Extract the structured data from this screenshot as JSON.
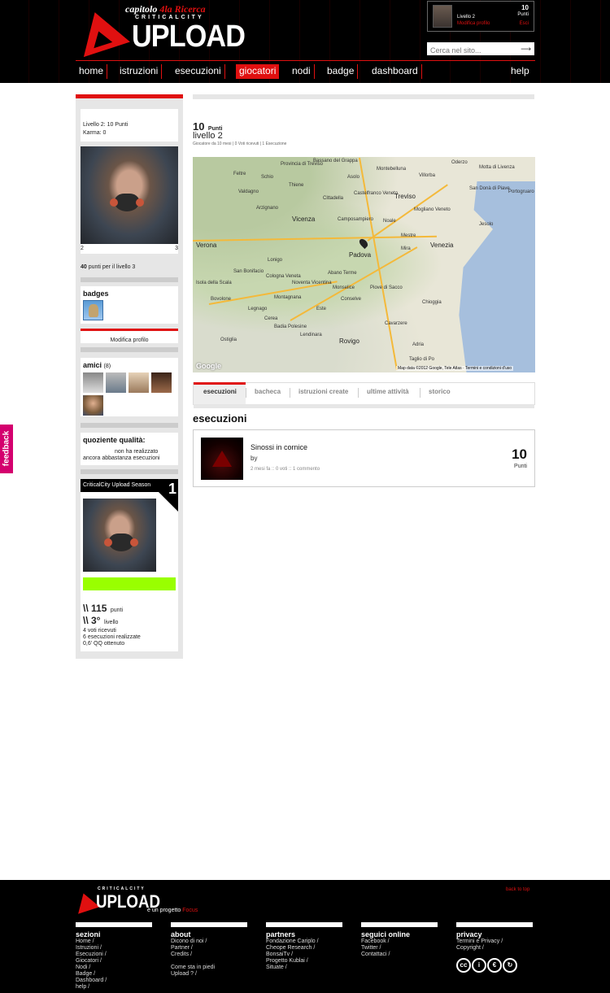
{
  "header": {
    "logo": {
      "kicker": "capitolo",
      "kicker_em": "4la Ricerca",
      "brand_small": "CRITICALCITY",
      "brand": "UPLOAD"
    },
    "user": {
      "level": "Livello 2",
      "edit": "Modifica profilo",
      "points": "10",
      "points_label": "Punti",
      "logout": "Esci"
    },
    "search": {
      "placeholder": "Cerca nel sito...",
      "go": "⟶"
    },
    "nav": [
      "home",
      "istruzioni",
      "esecuzioni",
      "giocatori",
      "nodi",
      "badge",
      "dashboard",
      "help"
    ],
    "nav_active": "giocatori"
  },
  "sidebar": {
    "level_line": "Livello 2: 10 Punti",
    "karma_line": "Karma: 0",
    "progress_left": "2",
    "progress_right": "3",
    "points_next_num": "40",
    "points_next_text": " punti per il livello 3",
    "badges_title": "badges",
    "edit_profile": "Modifica profilo",
    "friends_title": "amici",
    "friends_count": "(8)",
    "quality_title": "quoziente qualità:",
    "quality_text_1": "non ha realizzato",
    "quality_text_2": "ancora abbastanza esecuzioni",
    "season_title": "CriticalCity Upload Season",
    "season_num": "1",
    "season_points_num": "\\\\ 115",
    "season_points_label": "punti",
    "season_level_num": "\\\\ 3°",
    "season_level_label": "livello",
    "stat_votes": "4 voti ricevuti",
    "stat_execs": "6 esecuzioni realizzate",
    "stat_qq": "0,6' QQ ottenuto",
    "season_bar_color": "#99ff00"
  },
  "profile": {
    "points": "10",
    "points_label": "Punti",
    "level": "livello 2",
    "meta": "Giocatore da 10 mesi  |  0 Voti ricevuti  |  1 Esecuzione"
  },
  "map": {
    "labels": [
      "Provincia di Treviso",
      "Bassano del Grappa",
      "Feltre",
      "Asolo",
      "Schio",
      "Thiene",
      "Cittadella",
      "Castelfranco Veneto",
      "Vicenza",
      "Camposampiero",
      "Treviso",
      "Villorba",
      "Oderzo",
      "Motta di Livenza",
      "San Donà di Piave",
      "Jesolo",
      "Padova",
      "Mestre",
      "Venezia",
      "Mira",
      "Chioggia",
      "Abano Terme",
      "Piove di Sacco",
      "Conselve",
      "Este",
      "Montagnana",
      "Legnago",
      "Rovigo",
      "Lendinara",
      "Badia Polesine",
      "Adria",
      "Cavarzere",
      "Taglio di Po",
      "Verona",
      "San Bonifacio",
      "Lonigo",
      "Noventa Vicentina",
      "Monselice",
      "Arzignano",
      "Valdagno",
      "Montebelluna",
      "Noale",
      "Mogliano Veneto",
      "Portogruaro",
      "Ostiglia",
      "Cologna Veneta",
      "Isola della Scala",
      "Bovolone",
      "Cerea"
    ],
    "google": "Google",
    "attribution": "Map data ©2012 Google, Tele Atlas · Termini e condizioni d'uso"
  },
  "tabs": [
    "esecuzioni",
    "bacheca",
    "istruzioni create",
    "ultime attività",
    "storico"
  ],
  "section_title": "esecuzioni",
  "execution": {
    "title": "Sinossi in cornice",
    "by": "by",
    "meta": "2 mesi fa  ::  0 voti  ::  1 commento",
    "points": "10",
    "points_label": "Punti"
  },
  "feedback_tab": "feedback",
  "footer": {
    "back_to_top": "back to top",
    "project": "è un progetto",
    "project_name": "Focus",
    "columns": [
      {
        "title": "sezioni",
        "items": [
          "Home /",
          "Istruzioni /",
          "Esecuzioni /",
          "Giocatori /",
          "Nodi /",
          "Badge /",
          "Dashboard /",
          "help /"
        ]
      },
      {
        "title": "about",
        "items": [
          "Dicono di noi /",
          "Partner /",
          "Credits /",
          "",
          "Come sta in piedi",
          "Upload ? /"
        ]
      },
      {
        "title": "partners",
        "items": [
          "Fondazione Cariplo /",
          "Cheope Research /",
          "BonsaiTv /",
          "Progetto Kublai /",
          "Situate /"
        ]
      },
      {
        "title": "seguici online",
        "items": [
          "Facebook /",
          "Twitter /",
          "Contattaci /"
        ]
      },
      {
        "title": "privacy",
        "items": [
          "Termini e Privacy /",
          "Copyright /"
        ]
      }
    ],
    "cc_icons": [
      "cc",
      "by",
      "nc",
      "sa"
    ]
  }
}
